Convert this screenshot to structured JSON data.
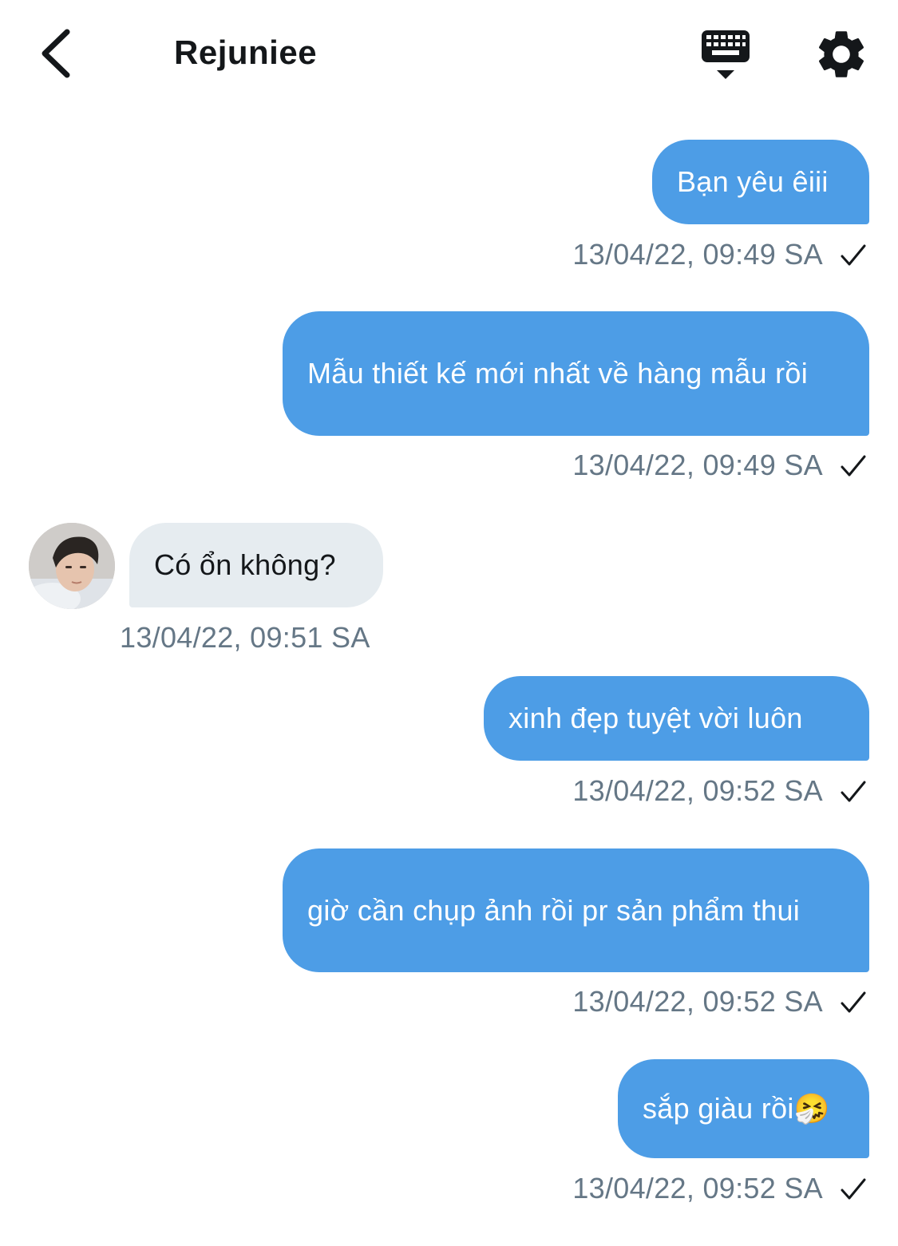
{
  "header": {
    "title": "Rejuniee",
    "back_icon": "chevron-left-icon",
    "keyboard_icon": "keyboard-icon",
    "settings_icon": "gear-icon"
  },
  "colors": {
    "outgoing_bubble": "#4d9de6",
    "incoming_bubble": "#e6ecf0",
    "timestamp": "#657786"
  },
  "messages": [
    {
      "direction": "out",
      "text": "Bạn yêu êiii",
      "time": "13/04/22, 09:49 SA",
      "read": true
    },
    {
      "direction": "out",
      "text": "Mẫu thiết kế mới nhất về hàng mẫu rồi",
      "time": "13/04/22, 09:49 SA",
      "read": true
    },
    {
      "direction": "in",
      "text": "Có ổn không?",
      "time": "13/04/22, 09:51 SA"
    },
    {
      "direction": "out",
      "text": "xinh đẹp tuyệt vời luôn",
      "time": "13/04/22, 09:52 SA",
      "read": true
    },
    {
      "direction": "out",
      "text": "giờ cần chụp ảnh rồi pr sản phẩm thui",
      "time": "13/04/22, 09:52 SA",
      "read": true
    },
    {
      "direction": "out",
      "text": "sắp giàu rồi🤧",
      "time": "13/04/22, 09:52 SA",
      "read": true
    }
  ]
}
